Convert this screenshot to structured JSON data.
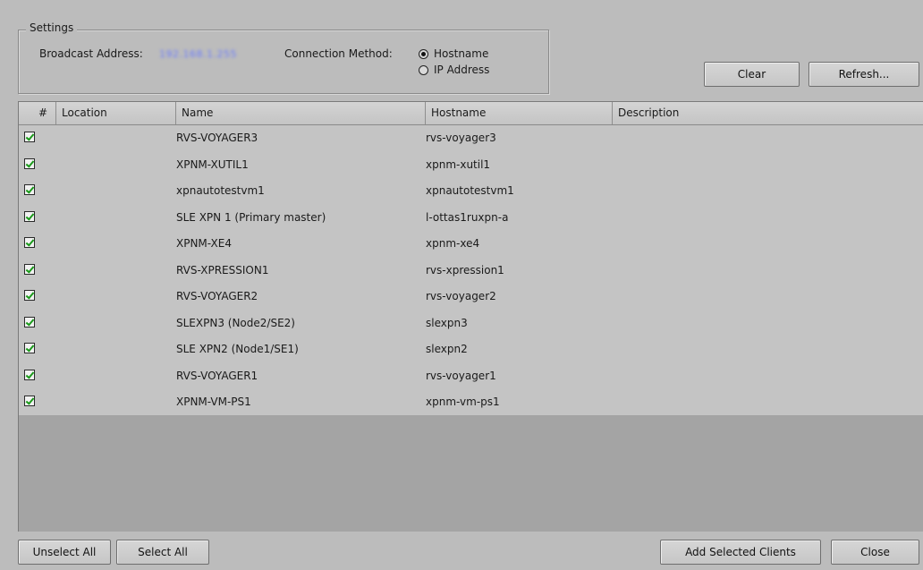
{
  "settings": {
    "title": "Settings",
    "broadcast_label": "Broadcast Address:",
    "broadcast_value": "192.168.1.255",
    "connection_label": "Connection Method:",
    "options": [
      {
        "label": "Hostname",
        "selected": true
      },
      {
        "label": "IP Address",
        "selected": false
      }
    ]
  },
  "buttons": {
    "clear": "Clear",
    "refresh": "Refresh...",
    "unselect_all": "Unselect All",
    "select_all": "Select All",
    "add_selected": "Add Selected Clients",
    "close": "Close"
  },
  "table": {
    "columns": [
      "#",
      "Location",
      "Name",
      "Hostname",
      "Description"
    ],
    "rows": [
      {
        "checked": true,
        "location": "",
        "name": "RVS-VOYAGER3",
        "hostname": "rvs-voyager3",
        "description": ""
      },
      {
        "checked": true,
        "location": "",
        "name": "XPNM-XUTIL1",
        "hostname": "xpnm-xutil1",
        "description": ""
      },
      {
        "checked": true,
        "location": "",
        "name": "xpnautotestvm1",
        "hostname": "xpnautotestvm1",
        "description": ""
      },
      {
        "checked": true,
        "location": "",
        "name": "SLE XPN 1 (Primary master)",
        "hostname": "l-ottas1ruxpn-a",
        "description": ""
      },
      {
        "checked": true,
        "location": "",
        "name": "XPNM-XE4",
        "hostname": "xpnm-xe4",
        "description": ""
      },
      {
        "checked": true,
        "location": "",
        "name": "RVS-XPRESSION1",
        "hostname": "rvs-xpression1",
        "description": ""
      },
      {
        "checked": true,
        "location": "",
        "name": "RVS-VOYAGER2",
        "hostname": "rvs-voyager2",
        "description": ""
      },
      {
        "checked": true,
        "location": "",
        "name": "SLEXPN3 (Node2/SE2)",
        "hostname": "slexpn3",
        "description": ""
      },
      {
        "checked": true,
        "location": "",
        "name": "SLE XPN2 (Node1/SE1)",
        "hostname": "slexpn2",
        "description": ""
      },
      {
        "checked": true,
        "location": "",
        "name": "RVS-VOYAGER1",
        "hostname": "rvs-voyager1",
        "description": ""
      },
      {
        "checked": true,
        "location": "",
        "name": "XPNM-VM-PS1",
        "hostname": "xpnm-vm-ps1",
        "description": ""
      }
    ]
  }
}
